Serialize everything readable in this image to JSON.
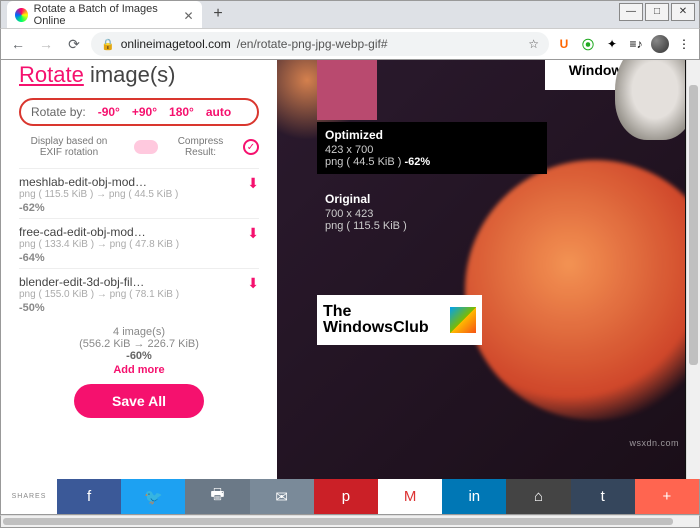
{
  "window": {
    "tab_title": "Rotate a Batch of Images Online",
    "min": "—",
    "max": "□",
    "close": "✕"
  },
  "address": {
    "url_domain": "onlineimagetool.com",
    "url_path": "/en/rotate-png-jpg-webp-gif#"
  },
  "page": {
    "title_rotate": "Rotate",
    "title_rest": " image(s)",
    "rotate_label": "Rotate by:",
    "rotate_opts": [
      "-90°",
      "+90°",
      "180°",
      "auto"
    ],
    "exif_label": "Display based on EXIF rotation",
    "compress_label": "Compress Result:"
  },
  "files": [
    {
      "name": "meshlab-edit-obj-mod…",
      "meta": "png ( 115.5 KiB ) → png ( 44.5 KiB )",
      "pct": "-62%"
    },
    {
      "name": "free-cad-edit-obj-mod…",
      "meta": "png ( 133.4 KiB ) → png ( 47.8 KiB )",
      "pct": "-64%"
    },
    {
      "name": "blender-edit-3d-obj-fil…",
      "meta": "png ( 155.0 KiB ) → png ( 78.1 KiB )",
      "pct": "-50%"
    }
  ],
  "summary": {
    "count": "4 image(s)",
    "sizes": "(556.2 KiB → 226.7 KiB)",
    "pct": "-60%",
    "add_more": "Add more"
  },
  "save_label": "Save All",
  "preview": {
    "wc_text": "WindowsClub",
    "opt": {
      "title": "Optimized",
      "dims": "423 x 700",
      "line": "png ( 44.5 KiB ) ",
      "pct": "-62%"
    },
    "orig": {
      "title": "Original",
      "dims": "700 x 423",
      "line": "png ( 115.5 KiB )"
    },
    "logo_text": "The WindowsClub"
  },
  "sharebar_label": "SHARES",
  "watermark": "wsxdn.com"
}
